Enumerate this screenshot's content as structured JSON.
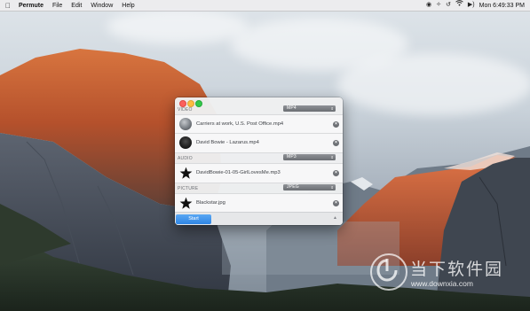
{
  "menubar": {
    "apple_icon": "apple-logo-icon",
    "app_name": "Permute",
    "menus": [
      "File",
      "Edit",
      "Window",
      "Help"
    ],
    "status_icons": [
      "permute-status-icon",
      "bluetooth-icon",
      "time-machine-icon",
      "wifi-icon",
      "volume-icon"
    ],
    "clock": "Mon 6:49:33 PM"
  },
  "window": {
    "sections": [
      {
        "label": "VIDEO",
        "format": "MP4",
        "files": [
          {
            "name": "Carriers at work, U.S. Post Office.mp4",
            "thumb": "photo-thumbnail"
          },
          {
            "name": "David Bowie - Lazarus.mp4",
            "thumb": "video-thumbnail"
          }
        ]
      },
      {
        "label": "AUDIO",
        "format": "MP3",
        "files": [
          {
            "name": "DavidBowie-01-05-GirlLovesMe.mp3",
            "thumb": "star-icon"
          }
        ]
      },
      {
        "label": "PICTURE",
        "format": "JPEG",
        "files": [
          {
            "name": "Blackstar.jpg",
            "thumb": "star-icon"
          }
        ]
      }
    ],
    "start_label": "Start",
    "collapse_icon": "chevron-up-icon"
  },
  "watermark": {
    "title": "当下软件园",
    "url": "www.downxia.com"
  },
  "colors": {
    "accent": "#3a8ee8",
    "close": "#fc605c",
    "minimize": "#fdbc40",
    "maximize": "#34c84a"
  }
}
